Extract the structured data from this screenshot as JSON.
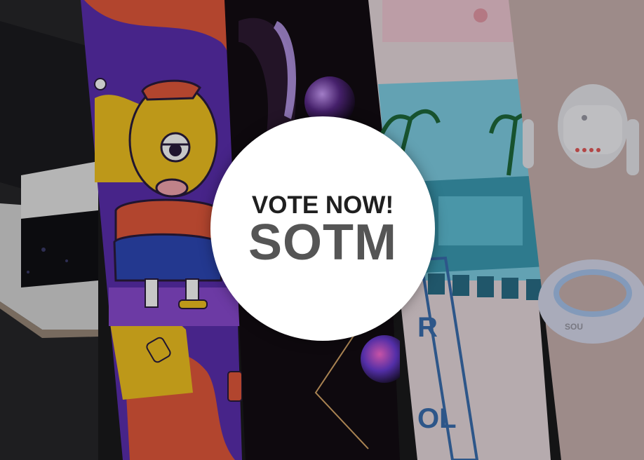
{
  "badge": {
    "line1": "VOTE NOW!",
    "line2": "SOTM"
  },
  "panels": [
    {
      "name": "3d-cube-scene",
      "color": "#2b2b2e"
    },
    {
      "name": "cartoon-cyclops-character",
      "color": "#5b2fb0"
    },
    {
      "name": "abstract-purple-spheres",
      "color": "#120c12"
    },
    {
      "name": "pool-resort-poster",
      "color": "#e9dcdf"
    },
    {
      "name": "white-robot-device",
      "color": "#c9b3b0"
    }
  ],
  "poster_letters": [
    "R",
    "OL"
  ],
  "device_label": "SOU"
}
